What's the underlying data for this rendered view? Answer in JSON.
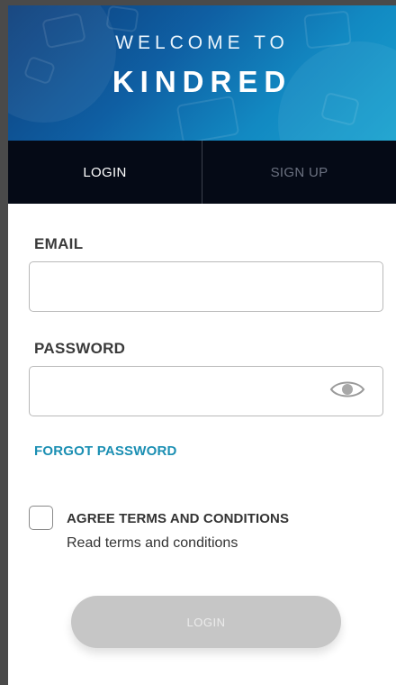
{
  "hero": {
    "line1": "WELCOME TO",
    "line2": "KINDRED"
  },
  "tabs": [
    {
      "label": "LOGIN",
      "active": true
    },
    {
      "label": "SIGN UP",
      "active": false
    }
  ],
  "form": {
    "email_label": "EMAIL",
    "email_value": "",
    "password_label": "PASSWORD",
    "password_value": "",
    "password_toggle_icon": "eye-icon",
    "forgot_label": "FORGOT PASSWORD",
    "agree_label": "AGREE TERMS AND CONDITIONS",
    "agree_checked": false,
    "read_terms_label": "Read terms and conditions",
    "submit_label": "LOGIN"
  },
  "colors": {
    "accent": "#1b8fb3",
    "tab_bar": "#050a16",
    "button_disabled": "#c6c6c6"
  }
}
